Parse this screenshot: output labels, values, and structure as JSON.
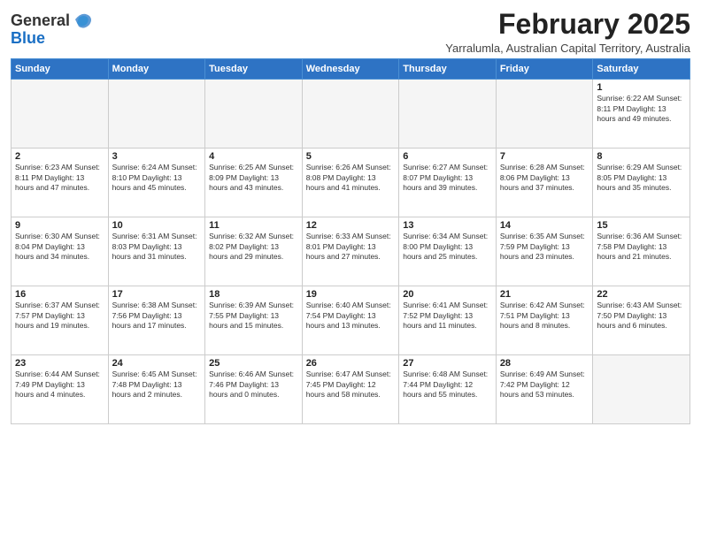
{
  "header": {
    "logo_general": "General",
    "logo_blue": "Blue",
    "month_title": "February 2025",
    "subtitle": "Yarralumla, Australian Capital Territory, Australia"
  },
  "days_of_week": [
    "Sunday",
    "Monday",
    "Tuesday",
    "Wednesday",
    "Thursday",
    "Friday",
    "Saturday"
  ],
  "weeks": [
    [
      {
        "day": "",
        "info": ""
      },
      {
        "day": "",
        "info": ""
      },
      {
        "day": "",
        "info": ""
      },
      {
        "day": "",
        "info": ""
      },
      {
        "day": "",
        "info": ""
      },
      {
        "day": "",
        "info": ""
      },
      {
        "day": "1",
        "info": "Sunrise: 6:22 AM\nSunset: 8:11 PM\nDaylight: 13 hours\nand 49 minutes."
      }
    ],
    [
      {
        "day": "2",
        "info": "Sunrise: 6:23 AM\nSunset: 8:11 PM\nDaylight: 13 hours\nand 47 minutes."
      },
      {
        "day": "3",
        "info": "Sunrise: 6:24 AM\nSunset: 8:10 PM\nDaylight: 13 hours\nand 45 minutes."
      },
      {
        "day": "4",
        "info": "Sunrise: 6:25 AM\nSunset: 8:09 PM\nDaylight: 13 hours\nand 43 minutes."
      },
      {
        "day": "5",
        "info": "Sunrise: 6:26 AM\nSunset: 8:08 PM\nDaylight: 13 hours\nand 41 minutes."
      },
      {
        "day": "6",
        "info": "Sunrise: 6:27 AM\nSunset: 8:07 PM\nDaylight: 13 hours\nand 39 minutes."
      },
      {
        "day": "7",
        "info": "Sunrise: 6:28 AM\nSunset: 8:06 PM\nDaylight: 13 hours\nand 37 minutes."
      },
      {
        "day": "8",
        "info": "Sunrise: 6:29 AM\nSunset: 8:05 PM\nDaylight: 13 hours\nand 35 minutes."
      }
    ],
    [
      {
        "day": "9",
        "info": "Sunrise: 6:30 AM\nSunset: 8:04 PM\nDaylight: 13 hours\nand 34 minutes."
      },
      {
        "day": "10",
        "info": "Sunrise: 6:31 AM\nSunset: 8:03 PM\nDaylight: 13 hours\nand 31 minutes."
      },
      {
        "day": "11",
        "info": "Sunrise: 6:32 AM\nSunset: 8:02 PM\nDaylight: 13 hours\nand 29 minutes."
      },
      {
        "day": "12",
        "info": "Sunrise: 6:33 AM\nSunset: 8:01 PM\nDaylight: 13 hours\nand 27 minutes."
      },
      {
        "day": "13",
        "info": "Sunrise: 6:34 AM\nSunset: 8:00 PM\nDaylight: 13 hours\nand 25 minutes."
      },
      {
        "day": "14",
        "info": "Sunrise: 6:35 AM\nSunset: 7:59 PM\nDaylight: 13 hours\nand 23 minutes."
      },
      {
        "day": "15",
        "info": "Sunrise: 6:36 AM\nSunset: 7:58 PM\nDaylight: 13 hours\nand 21 minutes."
      }
    ],
    [
      {
        "day": "16",
        "info": "Sunrise: 6:37 AM\nSunset: 7:57 PM\nDaylight: 13 hours\nand 19 minutes."
      },
      {
        "day": "17",
        "info": "Sunrise: 6:38 AM\nSunset: 7:56 PM\nDaylight: 13 hours\nand 17 minutes."
      },
      {
        "day": "18",
        "info": "Sunrise: 6:39 AM\nSunset: 7:55 PM\nDaylight: 13 hours\nand 15 minutes."
      },
      {
        "day": "19",
        "info": "Sunrise: 6:40 AM\nSunset: 7:54 PM\nDaylight: 13 hours\nand 13 minutes."
      },
      {
        "day": "20",
        "info": "Sunrise: 6:41 AM\nSunset: 7:52 PM\nDaylight: 13 hours\nand 11 minutes."
      },
      {
        "day": "21",
        "info": "Sunrise: 6:42 AM\nSunset: 7:51 PM\nDaylight: 13 hours\nand 8 minutes."
      },
      {
        "day": "22",
        "info": "Sunrise: 6:43 AM\nSunset: 7:50 PM\nDaylight: 13 hours\nand 6 minutes."
      }
    ],
    [
      {
        "day": "23",
        "info": "Sunrise: 6:44 AM\nSunset: 7:49 PM\nDaylight: 13 hours\nand 4 minutes."
      },
      {
        "day": "24",
        "info": "Sunrise: 6:45 AM\nSunset: 7:48 PM\nDaylight: 13 hours\nand 2 minutes."
      },
      {
        "day": "25",
        "info": "Sunrise: 6:46 AM\nSunset: 7:46 PM\nDaylight: 13 hours\nand 0 minutes."
      },
      {
        "day": "26",
        "info": "Sunrise: 6:47 AM\nSunset: 7:45 PM\nDaylight: 12 hours\nand 58 minutes."
      },
      {
        "day": "27",
        "info": "Sunrise: 6:48 AM\nSunset: 7:44 PM\nDaylight: 12 hours\nand 55 minutes."
      },
      {
        "day": "28",
        "info": "Sunrise: 6:49 AM\nSunset: 7:42 PM\nDaylight: 12 hours\nand 53 minutes."
      },
      {
        "day": "",
        "info": ""
      }
    ]
  ]
}
